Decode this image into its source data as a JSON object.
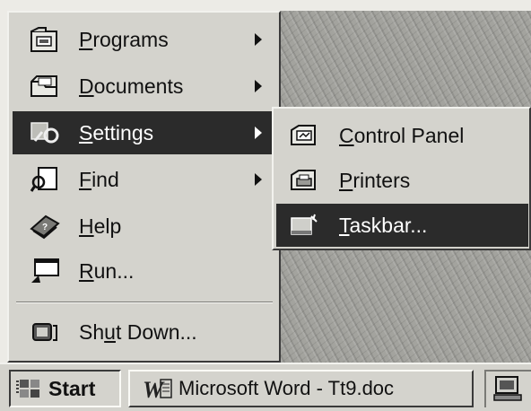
{
  "start_menu": {
    "items": [
      {
        "prefix": "",
        "mnemonic": "P",
        "rest": "rograms",
        "icon": "programs-folder-icon",
        "has_submenu": true
      },
      {
        "prefix": "",
        "mnemonic": "D",
        "rest": "ocuments",
        "icon": "documents-folder-icon",
        "has_submenu": true
      },
      {
        "prefix": "",
        "mnemonic": "S",
        "rest": "ettings",
        "icon": "settings-icon",
        "has_submenu": true,
        "selected": true
      },
      {
        "prefix": "",
        "mnemonic": "F",
        "rest": "ind",
        "icon": "find-icon",
        "has_submenu": true
      },
      {
        "prefix": "",
        "mnemonic": "H",
        "rest": "elp",
        "icon": "help-book-icon",
        "has_submenu": false
      },
      {
        "prefix": "",
        "mnemonic": "R",
        "rest": "un...",
        "icon": "run-icon",
        "has_submenu": false
      }
    ],
    "shutdown": {
      "prefix": "Sh",
      "mnemonic": "u",
      "rest": "t Down...",
      "icon": "shutdown-icon"
    }
  },
  "settings_submenu": {
    "items": [
      {
        "prefix": "",
        "mnemonic": "C",
        "rest": "ontrol Panel",
        "icon": "control-panel-icon"
      },
      {
        "prefix": "",
        "mnemonic": "P",
        "rest": "rinters",
        "icon": "printers-icon"
      },
      {
        "prefix": "",
        "mnemonic": "T",
        "rest": "askbar...",
        "icon": "taskbar-icon",
        "selected": true
      }
    ]
  },
  "taskbar": {
    "start_label": "Start",
    "task_label": "Microsoft Word - Tt9.doc",
    "task_icon": "word-w-icon",
    "tray_icon": "tray-icon"
  },
  "colors": {
    "menu_bg": "#d4d3cd",
    "highlight": "#2b2b2b",
    "highlight_text": "#ffffff"
  }
}
